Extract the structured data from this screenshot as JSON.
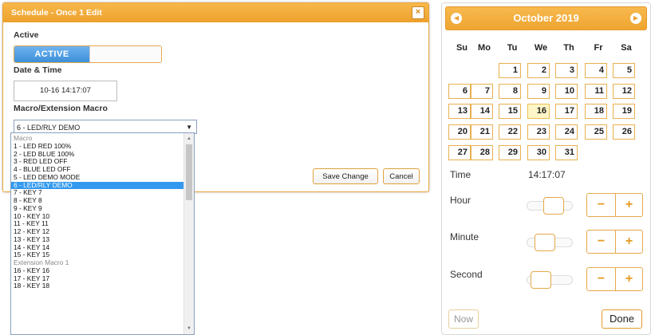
{
  "dialog": {
    "title": "Schedule - Once 1 Edit",
    "close_glyph": "×",
    "active_label": "Active",
    "toggle_on_label": "ACTIVE",
    "datetime_label": "Date & Time",
    "datetime_value": "10-16 14:17:07",
    "macro_label": "Macro/Extension Macro",
    "macro_selected": "6 - LED/RLY DEMO",
    "save_label": "Save Change",
    "cancel_label": "Cancel"
  },
  "dropdown": {
    "items": [
      {
        "text": "Macro",
        "type": "group"
      },
      {
        "text": "1 - LED RED 100%",
        "type": "option"
      },
      {
        "text": "2 - LED BLUE 100%",
        "type": "option"
      },
      {
        "text": "3 - RED LED OFF",
        "type": "option"
      },
      {
        "text": "4 - BLUE LED OFF",
        "type": "option"
      },
      {
        "text": "5 - LED DEMO MODE",
        "type": "option"
      },
      {
        "text": "6 - LED/RLY DEMO",
        "type": "selected"
      },
      {
        "text": "7 - KEY 7",
        "type": "option"
      },
      {
        "text": "8 - KEY 8",
        "type": "option"
      },
      {
        "text": "9 - KEY 9",
        "type": "option"
      },
      {
        "text": "10 - KEY 10",
        "type": "option"
      },
      {
        "text": "11 - KEY 11",
        "type": "option"
      },
      {
        "text": "12 - KEY 12",
        "type": "option"
      },
      {
        "text": "13 - KEY 13",
        "type": "option"
      },
      {
        "text": "14 - KEY 14",
        "type": "option"
      },
      {
        "text": "15 - KEY 15",
        "type": "option"
      },
      {
        "text": "Extension Macro 1",
        "type": "group"
      },
      {
        "text": "16 - KEY 16",
        "type": "option"
      },
      {
        "text": "17 - KEY 17",
        "type": "option"
      },
      {
        "text": "18 - KEY 18",
        "type": "option"
      }
    ],
    "selected_color": "#3399ee"
  },
  "calendar": {
    "month_title": "October 2019",
    "prev_glyph": "◀",
    "next_glyph": "▶",
    "weekdays": [
      "Su",
      "Mo",
      "Tu",
      "We",
      "Th",
      "Fr",
      "Sa"
    ],
    "weeks": [
      [
        "",
        "",
        "1",
        "2",
        "3",
        "4",
        "5"
      ],
      [
        "6",
        "7",
        "8",
        "9",
        "10",
        "11",
        "12"
      ],
      [
        "13",
        "14",
        "15",
        "16",
        "17",
        "18",
        "19"
      ],
      [
        "20",
        "21",
        "22",
        "23",
        "24",
        "25",
        "26"
      ],
      [
        "27",
        "28",
        "29",
        "30",
        "31",
        "",
        ""
      ]
    ],
    "today": "16",
    "time_label": "Time",
    "time_value": "14:17:07",
    "sliders": [
      {
        "label": "Hour",
        "fraction": 0.61
      },
      {
        "label": "Minute",
        "fraction": 0.29
      },
      {
        "label": "Second",
        "fraction": 0.12
      }
    ],
    "minus_glyph": "−",
    "plus_glyph": "+",
    "now_label": "Now",
    "done_label": "Done",
    "accent_color": "#eea531"
  }
}
